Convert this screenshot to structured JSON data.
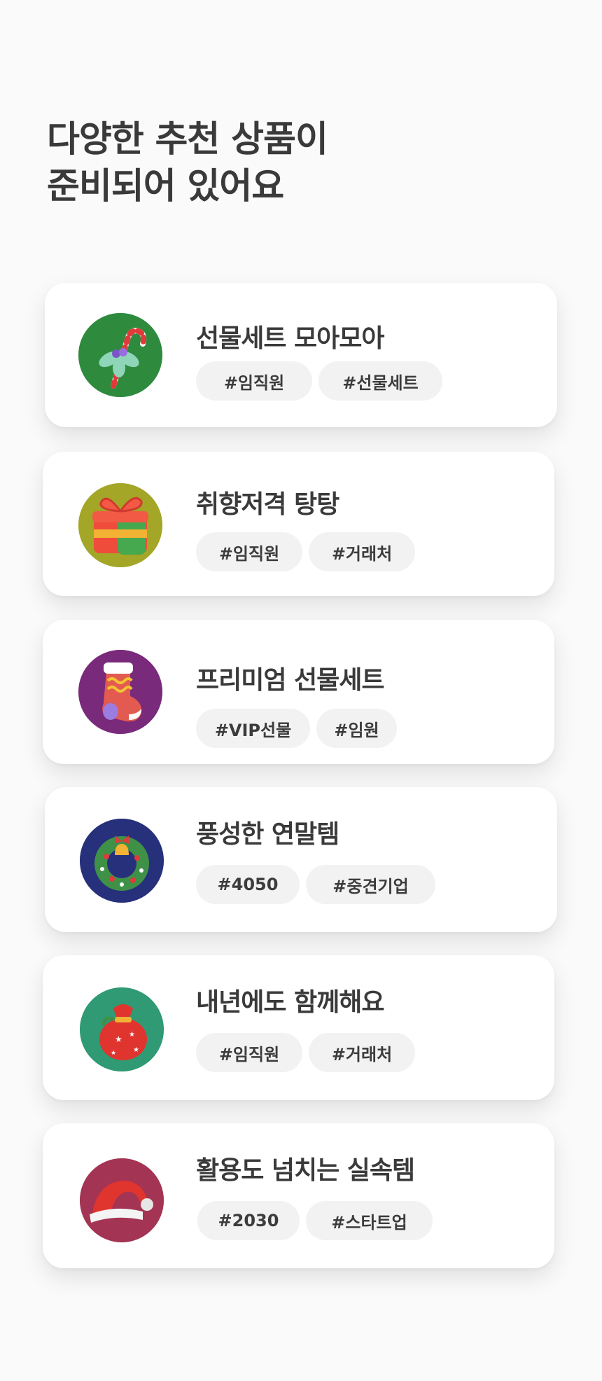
{
  "header": {
    "title_line1": "다양한 추천 상품이",
    "title_line2": "준비되어 있어요"
  },
  "cards": [
    {
      "title": "선물세트 모아모아",
      "tags": [
        "#임직원",
        "#선물세트"
      ],
      "icon": "candy-cane-icon",
      "bg": "#2e8b3e"
    },
    {
      "title": "취향저격 탕탕",
      "tags": [
        "#임직원",
        "#거래처"
      ],
      "icon": "gift-box-icon",
      "bg": "#a3a626"
    },
    {
      "title": "프리미엄 선물세트",
      "tags": [
        "#VIP선물",
        "#임원"
      ],
      "icon": "stocking-icon",
      "bg": "#7a2a7a"
    },
    {
      "title": "풍성한 연말템",
      "tags": [
        "#4050",
        "#중견기업"
      ],
      "icon": "wreath-icon",
      "bg": "#27307a"
    },
    {
      "title": "내년에도 함께해요",
      "tags": [
        "#임직원",
        "#거래처"
      ],
      "icon": "santa-sack-icon",
      "bg": "#2f9a74"
    },
    {
      "title": "활용도 넘치는 실속템",
      "tags": [
        "#2030",
        "#스타트업"
      ],
      "icon": "santa-hat-icon",
      "bg": "#a33453"
    }
  ]
}
